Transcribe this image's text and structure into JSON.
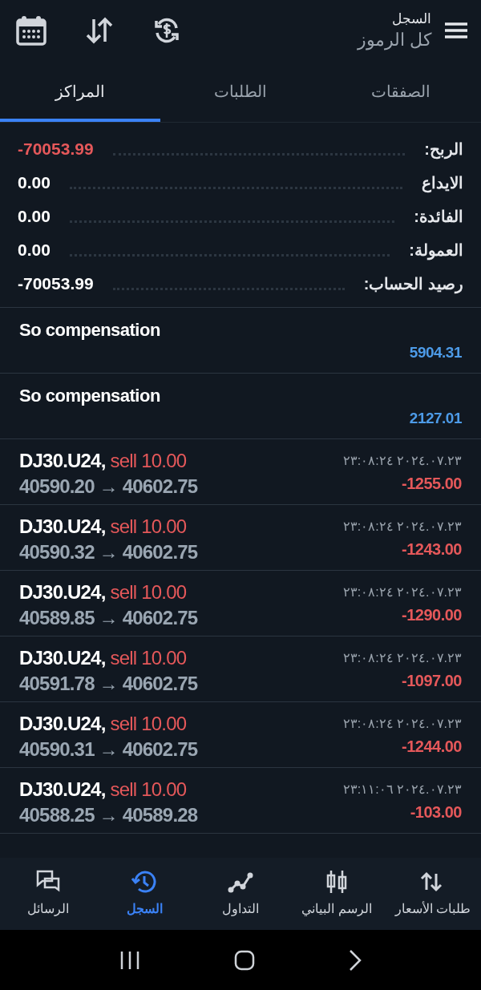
{
  "header": {
    "title": "السجل",
    "subtitle": "كل الرموز"
  },
  "tabs": [
    {
      "label": "الصفقات",
      "selected": false
    },
    {
      "label": "الطلبات",
      "selected": false
    },
    {
      "label": "المراكز",
      "selected": true
    }
  ],
  "summary": [
    {
      "label": "الربح:",
      "value": "-70053.99",
      "kind": "loss"
    },
    {
      "label": "الايداع",
      "value": "0.00",
      "kind": "plain"
    },
    {
      "label": "الفائدة:",
      "value": "0.00",
      "kind": "plain"
    },
    {
      "label": "العمولة:",
      "value": "0.00",
      "kind": "plain"
    },
    {
      "label": "رصيد الحساب:",
      "value": "-70053.99",
      "kind": "plain"
    }
  ],
  "balance_operations": [
    {
      "title": "So compensation",
      "amount": "5904.31"
    },
    {
      "title": "So compensation",
      "amount": "2127.01"
    }
  ],
  "deals": [
    {
      "symbol": "DJ30.U24,",
      "order": "sell 10.00",
      "prices": "40590.20 → 40602.75",
      "time": "٢٣:٠٨:٢٤ ٢٠٢٤.٠٧.٢٣",
      "profit": "-1255.00"
    },
    {
      "symbol": "DJ30.U24,",
      "order": "sell 10.00",
      "prices": "40590.32 → 40602.75",
      "time": "٢٣:٠٨:٢٤ ٢٠٢٤.٠٧.٢٣",
      "profit": "-1243.00"
    },
    {
      "symbol": "DJ30.U24,",
      "order": "sell 10.00",
      "prices": "40589.85 → 40602.75",
      "time": "٢٣:٠٨:٢٤ ٢٠٢٤.٠٧.٢٣",
      "profit": "-1290.00"
    },
    {
      "symbol": "DJ30.U24,",
      "order": "sell 10.00",
      "prices": "40591.78 → 40602.75",
      "time": "٢٣:٠٨:٢٤ ٢٠٢٤.٠٧.٢٣",
      "profit": "-1097.00"
    },
    {
      "symbol": "DJ30.U24,",
      "order": "sell 10.00",
      "prices": "40590.31 → 40602.75",
      "time": "٢٣:٠٨:٢٤ ٢٠٢٤.٠٧.٢٣",
      "profit": "-1244.00"
    },
    {
      "symbol": "DJ30.U24,",
      "order": "sell 10.00",
      "prices": "40588.25 → 40589.28",
      "time": "٢٣:١١:٠٦ ٢٠٢٤.٠٧.٢٣",
      "profit": "-103.00"
    }
  ],
  "bottom_nav": [
    {
      "label": "طلبات الأسعار",
      "kind": "quotes",
      "selected": false
    },
    {
      "label": "الرسم البياني",
      "kind": "chart",
      "selected": false
    },
    {
      "label": "التداول",
      "kind": "trade",
      "selected": false
    },
    {
      "label": "السجل",
      "kind": "history",
      "selected": true
    },
    {
      "label": "الرسائل",
      "kind": "messages",
      "selected": false
    }
  ]
}
